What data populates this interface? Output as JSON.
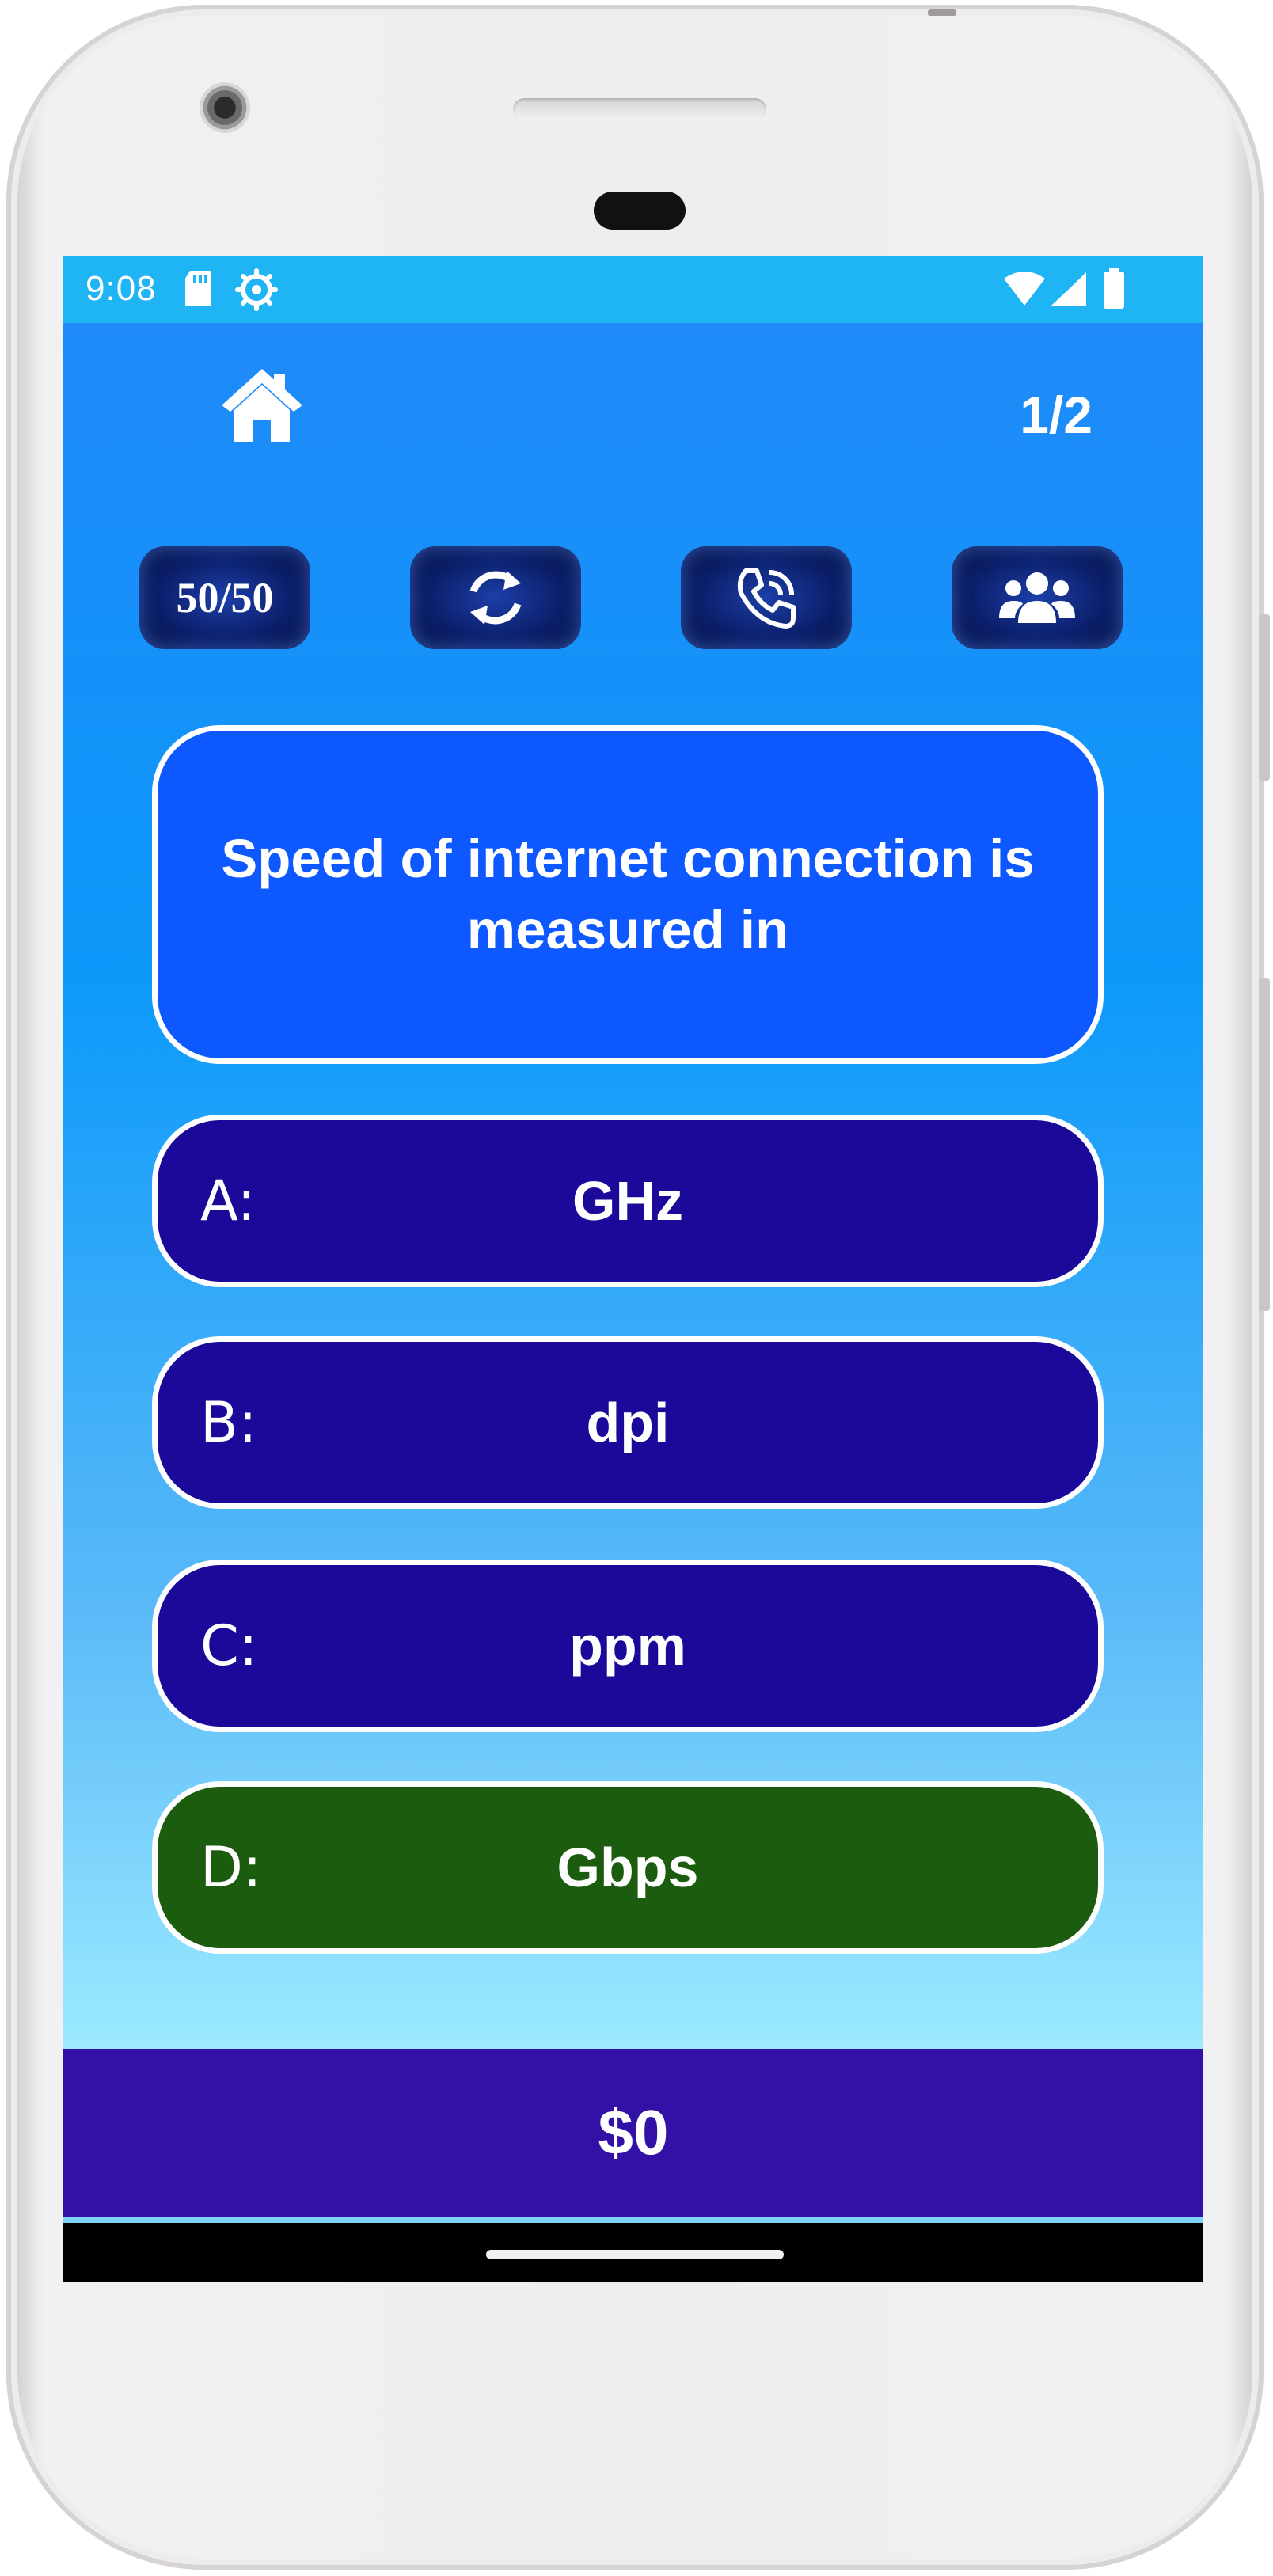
{
  "status_bar": {
    "time": "9:08",
    "icons": [
      "sd-card-icon",
      "settings-gear-icon",
      "wifi-icon",
      "cell-signal-icon",
      "battery-icon"
    ]
  },
  "header": {
    "home_icon": "home-icon",
    "question_counter": "1/2"
  },
  "lifelines": [
    {
      "name": "fifty-fifty",
      "label": "50/50"
    },
    {
      "name": "swap-question",
      "icon": "refresh-icon"
    },
    {
      "name": "phone-a-friend",
      "icon": "phone-call-icon"
    },
    {
      "name": "ask-audience",
      "icon": "audience-icon"
    }
  ],
  "question": {
    "text": "Speed of internet connection is measured in"
  },
  "answers": [
    {
      "letter": "A:",
      "text": "GHz",
      "state": "normal"
    },
    {
      "letter": "B:",
      "text": "dpi",
      "state": "normal"
    },
    {
      "letter": "C:",
      "text": "ppm",
      "state": "normal"
    },
    {
      "letter": "D:",
      "text": "Gbps",
      "state": "correct"
    }
  ],
  "prize": {
    "amount": "$0"
  },
  "colors": {
    "status_bar": "#1fb5f5",
    "question_box": "#0e58ff",
    "answer_normal": "#1b0a9a",
    "answer_correct": "#1c5c0f",
    "prize_bar": "#3411a6"
  }
}
